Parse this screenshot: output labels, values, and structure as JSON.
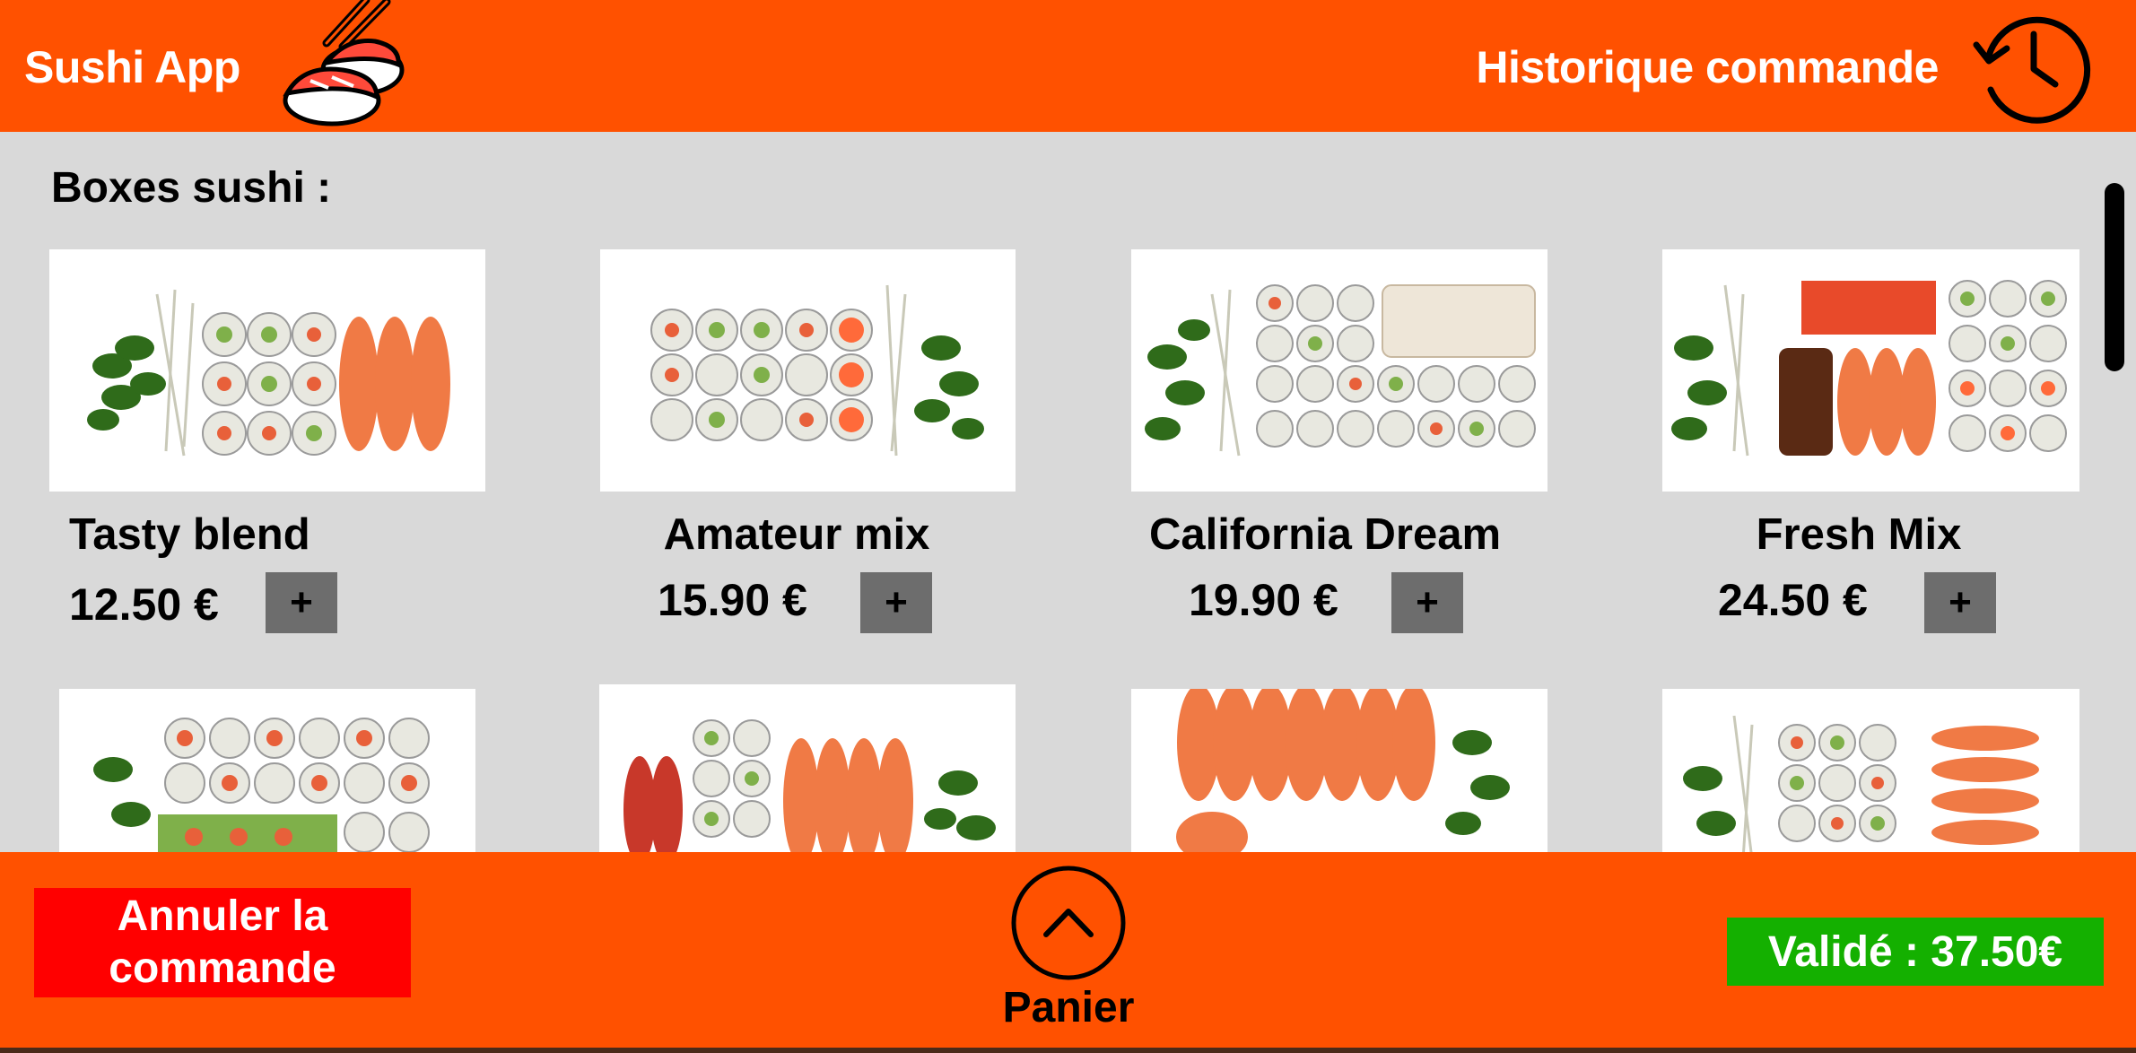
{
  "app": {
    "title": "Sushi App",
    "logo_icon": "sushi-chopsticks-icon"
  },
  "header": {
    "history_label": "Historique commande",
    "history_icon": "history-clock-icon"
  },
  "section": {
    "title": "Boxes sushi :"
  },
  "products": [
    {
      "name": "Tasty blend",
      "price": "12.50 €",
      "add_label": "+"
    },
    {
      "name": "Amateur mix",
      "price": "15.90 €",
      "add_label": "+"
    },
    {
      "name": "California Dream",
      "price": "19.90 €",
      "add_label": "+"
    },
    {
      "name": "Fresh Mix",
      "price": "24.50 €",
      "add_label": "+"
    }
  ],
  "footer": {
    "cancel_label": "Annuler la commande",
    "cart_label": "Panier",
    "cart_icon": "chevron-up-circle-icon",
    "validate_label": "Validé : 37.50€"
  },
  "colors": {
    "brand_orange": "#ff5100",
    "background": "#d9d9d9",
    "cancel_red": "#ff0000",
    "validate_green": "#14b000",
    "add_button_grey": "#6d6d6d"
  }
}
